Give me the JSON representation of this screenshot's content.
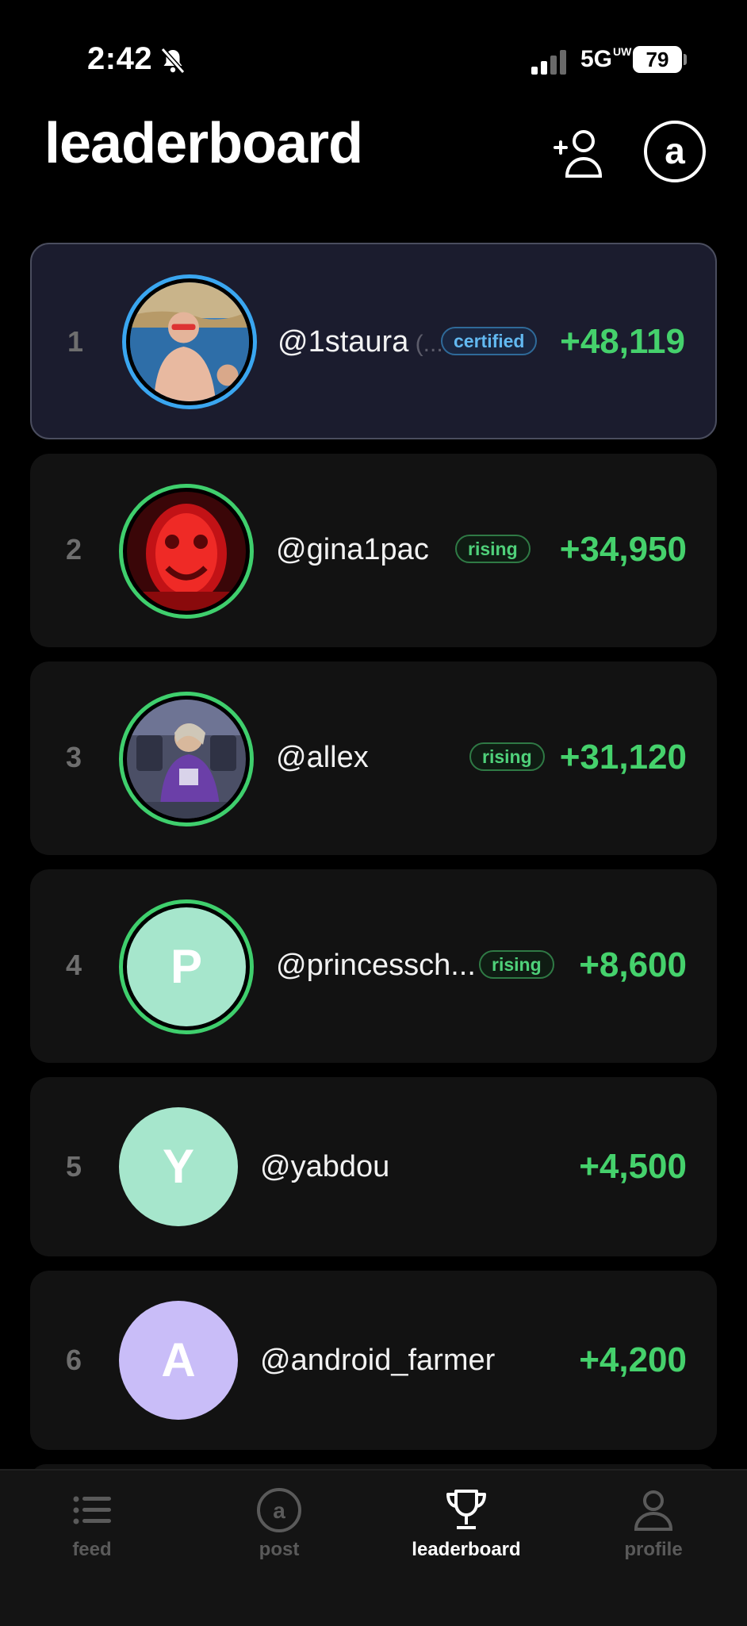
{
  "status_bar": {
    "time": "2:42",
    "network": "5G",
    "network_sup": "UW",
    "battery": "79"
  },
  "header": {
    "title": "leaderboard",
    "account_initial": "a"
  },
  "rows": [
    {
      "rank": "1",
      "username": "@1staura",
      "trunc": " (...",
      "badge": "certified",
      "score": "+48,119"
    },
    {
      "rank": "2",
      "username": "@gina1pac",
      "badge": "rising",
      "score": "+34,950"
    },
    {
      "rank": "3",
      "username": "@allex",
      "badge": "rising",
      "score": "+31,120"
    },
    {
      "rank": "4",
      "username": "@princessch...",
      "badge": "rising",
      "avatar_initial": "P",
      "score": "+8,600"
    },
    {
      "rank": "5",
      "username": "@yabdou",
      "avatar_initial": "Y",
      "score": "+4,500"
    },
    {
      "rank": "6",
      "username": "@android_farmer",
      "avatar_initial": "A",
      "score": "+4,200"
    }
  ],
  "tabs": [
    {
      "label": "feed",
      "icon": "list-icon"
    },
    {
      "label": "post",
      "icon": "post-icon",
      "glyph": "a"
    },
    {
      "label": "leaderboard",
      "icon": "trophy-icon",
      "active": true
    },
    {
      "label": "profile",
      "icon": "person-icon"
    }
  ],
  "colors": {
    "background": "#000000",
    "row": "#121212",
    "row_highlight": "#1b1c2e",
    "score_green": "#45d16c",
    "ring_blue": "#3aa6f0",
    "ring_green": "#3fcf6d",
    "avatar_mint": "#a6e6cc",
    "avatar_lavender": "#c9bdf8"
  }
}
